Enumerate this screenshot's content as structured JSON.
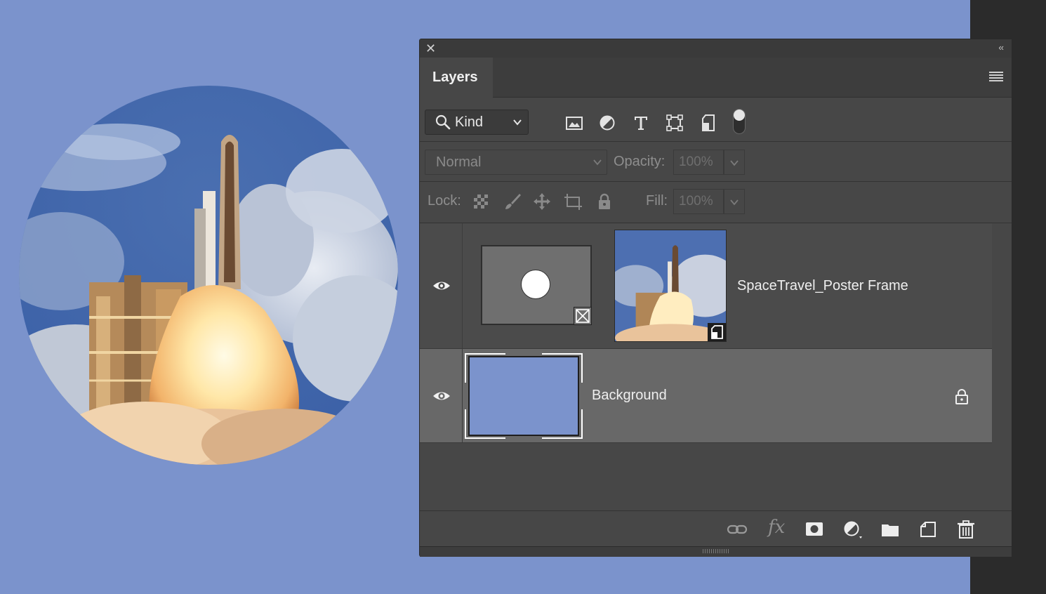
{
  "canvas": {
    "background_color": "#7b93cc",
    "image_subject": "space-shuttle-launch"
  },
  "panel": {
    "close_label": "✕",
    "collapse_label": "‹‹",
    "tab_label": "Layers",
    "menu_icon": "panel-menu-icon"
  },
  "filter": {
    "kind_label": "Kind",
    "icons": [
      "image-filter-icon",
      "adjustment-filter-icon",
      "type-filter-icon",
      "shape-filter-icon",
      "smart-object-filter-icon"
    ],
    "toggle_on": true
  },
  "blend": {
    "mode": "Normal",
    "opacity_label": "Opacity:",
    "opacity_value": "100%"
  },
  "lock": {
    "label": "Lock:",
    "icons": [
      "lock-transparent-pixels-icon",
      "lock-image-pixels-icon",
      "lock-position-icon",
      "lock-artboard-icon",
      "lock-all-icon"
    ],
    "fill_label": "Fill:",
    "fill_value": "100%"
  },
  "layers": [
    {
      "name": "SpaceTravel_Poster Frame",
      "visible": true,
      "type": "frame"
    },
    {
      "name": "Background",
      "visible": true,
      "locked": true,
      "type": "background",
      "color": "#7b93cc"
    }
  ],
  "bottom_bar": {
    "icons": [
      "link-layers-icon",
      "fx-icon",
      "add-mask-icon",
      "adjustment-layer-icon",
      "new-group-icon",
      "new-layer-icon",
      "delete-icon"
    ],
    "fx_label": "fx"
  }
}
